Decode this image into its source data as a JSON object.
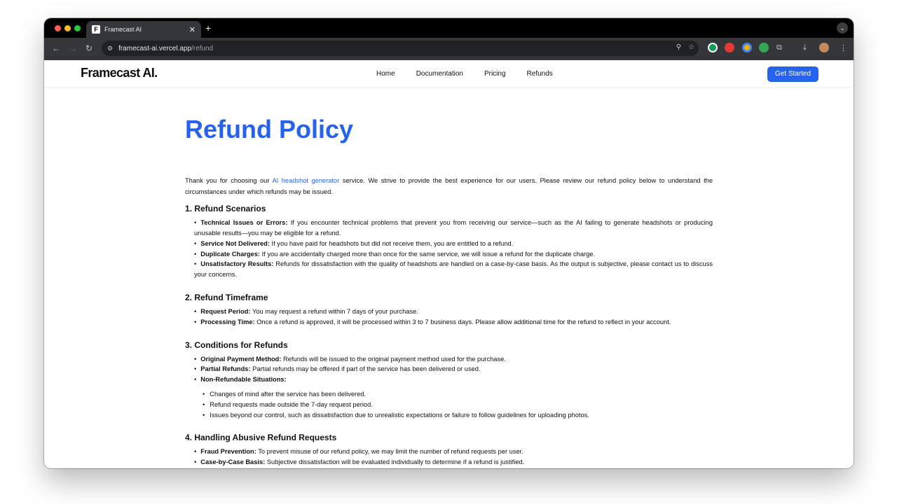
{
  "browser": {
    "tab_title": "Framecast AI",
    "favicon_letter": "F",
    "url_host": "framecast-ai.vercel.app",
    "url_path": "/refund"
  },
  "site": {
    "logo": "Framecast AI.",
    "nav": [
      "Home",
      "Documentation",
      "Pricing",
      "Refunds"
    ],
    "cta": "Get Started"
  },
  "content": {
    "title": "Refund Policy",
    "intro_pre": "Thank you for choosing our ",
    "intro_link": "AI headshot generator",
    "intro_post": " service. We strive to provide the best experience for our users. Please review our refund policy below to understand the circumstances under which refunds may be issued.",
    "sections": [
      {
        "heading": "1. Refund Scenarios",
        "items": [
          {
            "label": "Technical Issues or Errors:",
            "text": " If you encounter technical problems that prevent you from receiving our service—such as the AI failing to generate headshots or producing unusable results—you may be eligible for a refund."
          },
          {
            "label": "Service Not Delivered:",
            "text": " If you have paid for headshots but did not receive them, you are entitled to a refund."
          },
          {
            "label": "Duplicate Charges:",
            "text": " If you are accidentally charged more than once for the same service, we will issue a refund for the duplicate charge."
          },
          {
            "label": "Unsatisfactory Results:",
            "text": " Refunds for dissatisfaction with the quality of headshots are handled on a case-by-case basis. As the output is subjective, please contact us to discuss your concerns."
          }
        ]
      },
      {
        "heading": "2. Refund Timeframe",
        "items": [
          {
            "label": "Request Period:",
            "text": " You may request a refund within 7 days of your purchase."
          },
          {
            "label": "Processing Time:",
            "text": " Once a refund is approved, it will be processed within 3 to 7 business days. Please allow additional time for the refund to reflect in your account."
          }
        ]
      },
      {
        "heading": "3. Conditions for Refunds",
        "items": [
          {
            "label": "Original Payment Method:",
            "text": " Refunds will be issued to the original payment method used for the purchase."
          },
          {
            "label": "Partial Refunds:",
            "text": " Partial refunds may be offered if part of the service has been delivered or used."
          },
          {
            "label": "Non-Refundable Situations:",
            "text": ""
          }
        ],
        "subitems": [
          "Changes of mind after the service has been delivered.",
          "Refund requests made outside the 7-day request period.",
          "Issues beyond our control, such as dissatisfaction due to unrealistic expectations or failure to follow guidelines for uploading photos."
        ]
      },
      {
        "heading": "4. Handling Abusive Refund Requests",
        "items": [
          {
            "label": "Fraud Prevention:",
            "text": " To prevent misuse of our refund policy, we may limit the number of refund requests per user."
          },
          {
            "label": "Case-by-Case Basis:",
            "text": " Subjective dissatisfaction will be evaluated individually to determine if a refund is justified."
          }
        ]
      }
    ]
  }
}
